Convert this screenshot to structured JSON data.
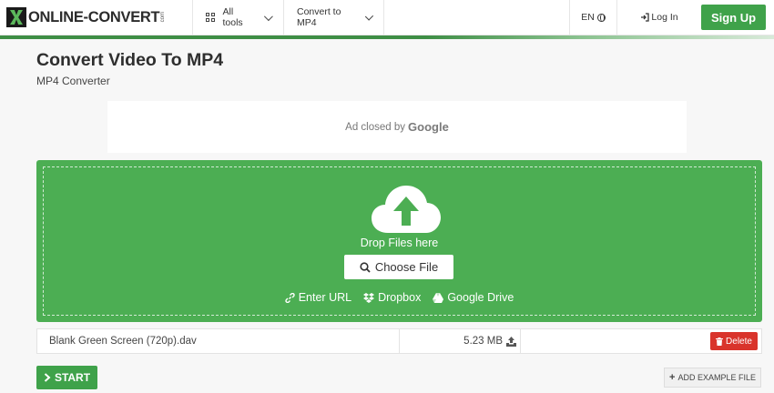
{
  "header": {
    "logo_text": "ONLINE-CONVERT",
    "logo_suffix": "com",
    "all_tools": "All tools",
    "convert_to": "Convert to MP4",
    "language": "EN",
    "login": "Log In",
    "signup": "Sign Up"
  },
  "page": {
    "title": "Convert Video To MP4",
    "subtitle": "MP4 Converter"
  },
  "ad": {
    "text": "Ad closed by",
    "brand": "Google"
  },
  "dropzone": {
    "drop_text": "Drop Files here",
    "choose_file": "Choose File",
    "sources": [
      "Enter URL",
      "Dropbox",
      "Google Drive"
    ]
  },
  "file": {
    "name": "Blank Green Screen (720p).dav",
    "size": "5.23 MB",
    "delete_label": "Delete"
  },
  "actions": {
    "start": "START",
    "add_example": "ADD EXAMPLE FILE"
  },
  "colors": {
    "brand_green": "#3fa24a",
    "dropzone_green": "#4cae53",
    "delete_red": "#d9342b"
  }
}
